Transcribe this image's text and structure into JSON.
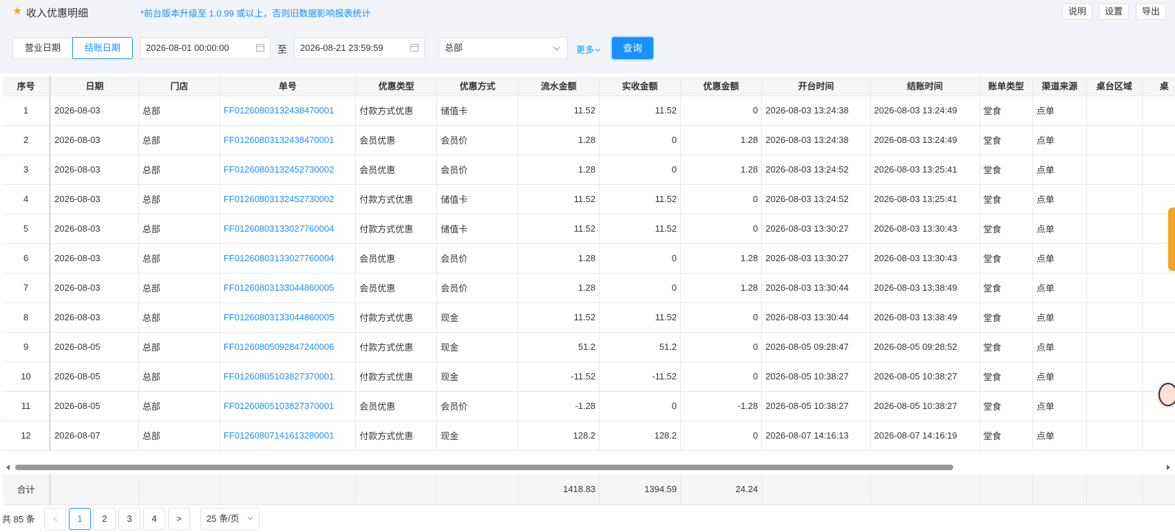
{
  "header": {
    "title": "收入优惠明细",
    "notice": "*前台版本升级至 1.0.99 或以上，否则旧数据影响报表统计",
    "buttons": [
      "说明",
      "设置",
      "导出"
    ]
  },
  "filters": {
    "date_tabs": [
      "营业日期",
      "结账日期"
    ],
    "active_date_tab": "结账日期",
    "start_datetime": "2026-08-01 00:00:00",
    "to_label": "至",
    "end_datetime": "2026-08-21 23:59:59",
    "store": "总部",
    "more_label": "更多",
    "query_label": "查询"
  },
  "table": {
    "columns": [
      "序号",
      "日期",
      "门店",
      "单号",
      "优惠类型",
      "优惠方式",
      "流水金额",
      "实收金额",
      "优惠金额",
      "开台时间",
      "结账时间",
      "账单类型",
      "渠道来源",
      "桌台区域",
      "桌"
    ],
    "rows": [
      [
        "1",
        "2026-08-03",
        "总部",
        "FF01260803132438470001",
        "付款方式优惠",
        "储值卡",
        "11.52",
        "11.52",
        "0",
        "2026-08-03 13:24:38",
        "2026-08-03 13:24:49",
        "堂食",
        "点单",
        ""
      ],
      [
        "2",
        "2026-08-03",
        "总部",
        "FF01260803132438470001",
        "会员优惠",
        "会员价",
        "1.28",
        "0",
        "1.28",
        "2026-08-03 13:24:38",
        "2026-08-03 13:24:49",
        "堂食",
        "点单",
        ""
      ],
      [
        "3",
        "2026-08-03",
        "总部",
        "FF01260803132452730002",
        "会员优惠",
        "会员价",
        "1.28",
        "0",
        "1.28",
        "2026-08-03 13:24:52",
        "2026-08-03 13:25:41",
        "堂食",
        "点单",
        ""
      ],
      [
        "4",
        "2026-08-03",
        "总部",
        "FF01260803132452730002",
        "付款方式优惠",
        "储值卡",
        "11.52",
        "11.52",
        "0",
        "2026-08-03 13:24:52",
        "2026-08-03 13:25:41",
        "堂食",
        "点单",
        ""
      ],
      [
        "5",
        "2026-08-03",
        "总部",
        "FF01260803133027760004",
        "付款方式优惠",
        "储值卡",
        "11.52",
        "11.52",
        "0",
        "2026-08-03 13:30:27",
        "2026-08-03 13:30:43",
        "堂食",
        "点单",
        ""
      ],
      [
        "6",
        "2026-08-03",
        "总部",
        "FF01260803133027760004",
        "会员优惠",
        "会员价",
        "1.28",
        "0",
        "1.28",
        "2026-08-03 13:30:27",
        "2026-08-03 13:30:43",
        "堂食",
        "点单",
        ""
      ],
      [
        "7",
        "2026-08-03",
        "总部",
        "FF01260803133044860005",
        "会员优惠",
        "会员价",
        "1.28",
        "0",
        "1.28",
        "2026-08-03 13:30:44",
        "2026-08-03 13:38:49",
        "堂食",
        "点单",
        ""
      ],
      [
        "8",
        "2026-08-03",
        "总部",
        "FF01260803133044860005",
        "付款方式优惠",
        "现金",
        "11.52",
        "11.52",
        "0",
        "2026-08-03 13:30:44",
        "2026-08-03 13:38:49",
        "堂食",
        "点单",
        ""
      ],
      [
        "9",
        "2026-08-05",
        "总部",
        "FF01260805092847240006",
        "付款方式优惠",
        "现金",
        "51.2",
        "51.2",
        "0",
        "2026-08-05 09:28:47",
        "2026-08-05 09:28:52",
        "堂食",
        "点单",
        ""
      ],
      [
        "10",
        "2026-08-05",
        "总部",
        "FF01260805103827370001",
        "付款方式优惠",
        "现金",
        "-11.52",
        "-11.52",
        "0",
        "2026-08-05 10:38:27",
        "2026-08-05 10:38:27",
        "堂食",
        "点单",
        ""
      ],
      [
        "11",
        "2026-08-05",
        "总部",
        "FF01260805103827370001",
        "会员优惠",
        "会员价",
        "-1.28",
        "0",
        "-1.28",
        "2026-08-05 10:38:27",
        "2026-08-05 10:38:27",
        "堂食",
        "点单",
        ""
      ],
      [
        "12",
        "2026-08-07",
        "总部",
        "FF01260807141613280001",
        "付款方式优惠",
        "现金",
        "128.2",
        "128.2",
        "0",
        "2026-08-07 14:16:13",
        "2026-08-07 14:16:19",
        "堂食",
        "点单",
        ""
      ]
    ],
    "summary": {
      "label": "合计",
      "flow_amount": "1418.83",
      "received_amount": "1394.59",
      "discount_amount": "24.24"
    }
  },
  "pagination": {
    "total_label": "共 85 条",
    "pages": [
      "1",
      "2",
      "3",
      "4"
    ],
    "current_page": "1",
    "page_size_label": "25 条/页"
  },
  "colors": {
    "accent": "#1890ff",
    "star": "#f5a623",
    "header_bg": "#f2f4f7"
  }
}
